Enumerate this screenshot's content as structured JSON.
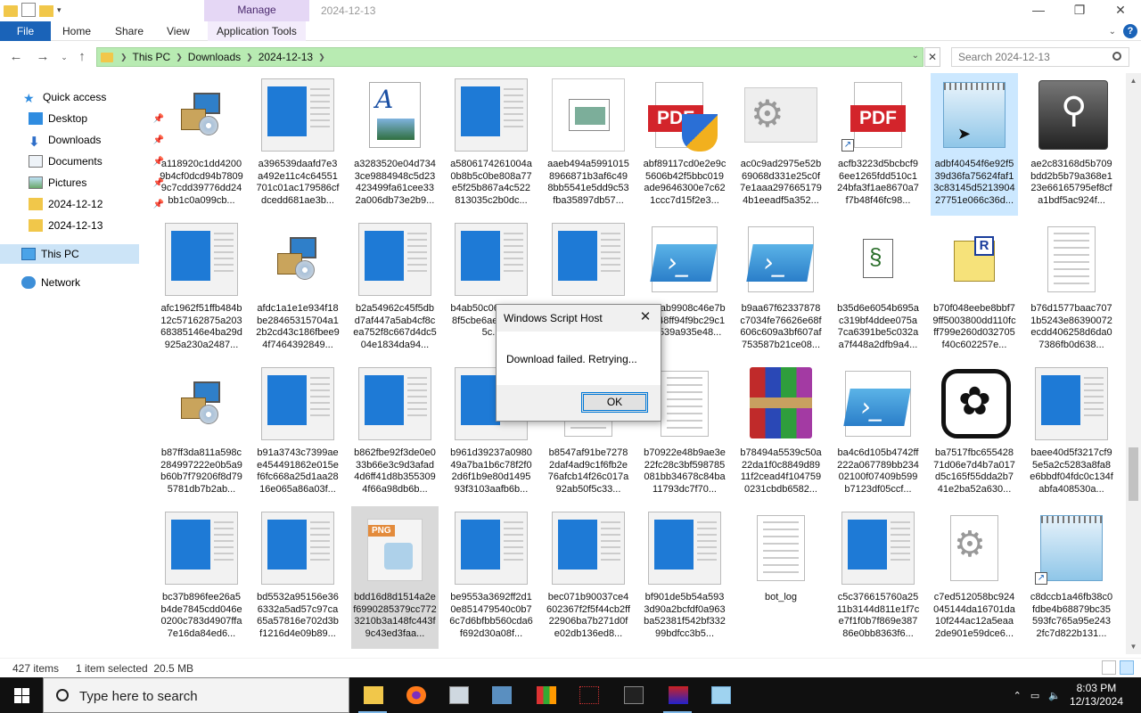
{
  "window": {
    "title": "2024-12-13",
    "manage_tab": "Manage",
    "minimize": "—",
    "restore": "❐",
    "close": "✕"
  },
  "ribbon": {
    "tabs": [
      "File",
      "Home",
      "Share",
      "View",
      "Application Tools"
    ],
    "help": "?"
  },
  "address": {
    "crumbs": [
      "This PC",
      "Downloads",
      "2024-12-13"
    ],
    "search_placeholder": "Search 2024-12-13"
  },
  "nav": {
    "items": [
      {
        "label": "Quick access"
      },
      {
        "label": "Desktop"
      },
      {
        "label": "Downloads"
      },
      {
        "label": "Documents"
      },
      {
        "label": "Pictures"
      },
      {
        "label": "2024-12-12"
      },
      {
        "label": "2024-12-13"
      },
      {
        "label": "This PC"
      },
      {
        "label": "Network"
      }
    ]
  },
  "files": [
    {
      "name": "a118920c1dd42009b4cf0dcd94b78099c7cdd39776dd24bb1c0a099cb...",
      "icon": "installer"
    },
    {
      "name": "a396539daafd7e3a492e11c4c64551701c01ac179586cfdcedd681ae3b...",
      "icon": "doc"
    },
    {
      "name": "a3283520e04d7343ce9884948c5d23423499fa61cee332a006db73e2b9...",
      "icon": "word"
    },
    {
      "name": "a5806174261004a0b8b5c0be808a77e5f25b867a4c522813035c2b0dc...",
      "icon": "doc"
    },
    {
      "name": "aaeb494a59910158966871b3af6c498bb5541e5dd9c53fba35897db57...",
      "icon": "window"
    },
    {
      "name": "abf89117cd0e2e9c5606b42f5bbc019ade9646300e7c621ccc7d15f2e3...",
      "icon": "pdf-shield"
    },
    {
      "name": "ac0c9ad2975e52b69068d331e25c0f7e1aaa2976651794b1eeadf5a352...",
      "icon": "gear"
    },
    {
      "name": "acfb3223d5bcbcf96ee1265fdd510c124bfa3f1ae8670a7f7b48f46fc98...",
      "icon": "pdf-link"
    },
    {
      "name": "adbf40454f6e92f539d36fa75624faf13c83145d521390427751e066c36d...",
      "icon": "notepad-sel"
    },
    {
      "name": "ae2c83168d5b709bdd2b5b79a368e123e66165795ef8cfa1bdf5ac924f...",
      "icon": "usb"
    },
    {
      "name": "afc1962f51ffb484b12c57162875a20368385146e4ba29d925a230a2487...",
      "icon": "doc"
    },
    {
      "name": "afdc1a1e1e934f18be28465315704a12b2cd43c186fbee94f7464392849...",
      "icon": "installer"
    },
    {
      "name": "b2a54962c45f5dbd7af447a5ab4cf8cea752f8c667d4dc504e1834da94...",
      "icon": "doc"
    },
    {
      "name": "b4ab50c06764d4b8f5cbe6aedb5e445c...",
      "icon": "doc"
    },
    {
      "name": "",
      "icon": "doc"
    },
    {
      "name": "b8dab9908c46e7bdf048ff94f9bc29c15b539a935e48...",
      "icon": "ps"
    },
    {
      "name": "b9aa67f62337878c7034fe76626e68f606c609a3bf607af753587b21ce08...",
      "icon": "ps"
    },
    {
      "name": "b35d6e6054b695ac319bf4ddee075a7ca6391be5c032aa7f448a2dfb9a4...",
      "icon": "script"
    },
    {
      "name": "b70f048eebe8bbf79ff5003800dd110fcff799e260d032705f40c602257e...",
      "icon": "rfile"
    },
    {
      "name": "b76d1577baac7071b5243e86390072ecdd406258d6da07386fb0d638...",
      "icon": "text"
    },
    {
      "name": "b87ff3da811a598c284997222e0b5a9b60b7f79206f8d795781db7b2ab...",
      "icon": "installer"
    },
    {
      "name": "b91a3743c7399aee454491862e015ef6fc668a25d1aa2816e065a86a03f...",
      "icon": "doc"
    },
    {
      "name": "b862fbe92f3de0e033b66e3c9d3afad4d6ff41d8b3553094f66a98db6b...",
      "icon": "doc"
    },
    {
      "name": "b961d39237a098049a7ba1b6c78f2f02d6f1b9e80d149593f3103aafb6b...",
      "icon": "doc"
    },
    {
      "name": "b8547af91be72782daf4ad9c1f6fb2e76afcb14f26c017a92ab50f5c33...",
      "icon": "text"
    },
    {
      "name": "b70922e48b9ae3e22fc28c3bf598785081bb34678c84ba11793dc7f70...",
      "icon": "text"
    },
    {
      "name": "b78494a5539c50a22da1f0c8849d8911f2cead4f1047590231cbdb6582...",
      "icon": "rar"
    },
    {
      "name": "ba4c6d105b4742ff222a067789bb23402100f07409b599b7123df05ccf...",
      "icon": "ps"
    },
    {
      "name": "ba7517fbc65542871d06e7d4b7a017d5c165f55dda2b741e2ba52a630...",
      "icon": "openai"
    },
    {
      "name": "baee40d5f3217cf95e5a2c5283a8fa8e6bbdf04fdc0c134fabfa408530a...",
      "icon": "doc"
    },
    {
      "name": "bc37b896fee26a5b4de7845cdd046e0200c783d4907ffa7e16da84ed6...",
      "icon": "doc"
    },
    {
      "name": "bd5532a95156e366332a5ad57c97ca65a57816e702d3bf1216d4e09b89...",
      "icon": "doc"
    },
    {
      "name": "bdd16d8d1514a2ef6990285379cc7723210b3a148fc443f9c43ed3faa...",
      "icon": "png"
    },
    {
      "name": "be9553a3692ff2d10e851479540c0b76c7d6bfbb560cda6f692d30a08f...",
      "icon": "doc"
    },
    {
      "name": "bec071b90037ce4602367f2f5f44cb2ff22906ba7b271d0fe02db136ed8...",
      "icon": "doc"
    },
    {
      "name": "bf901de5b54a5933d90a2bcfdf0a963ba52381f542bf33299bdfcc3b5...",
      "icon": "doc"
    },
    {
      "name": "bot_log",
      "icon": "text"
    },
    {
      "name": "c5c376615760a2511b3144d811e1f7ce7f1f0b7f869e38786e0bb8363f6...",
      "icon": "doc"
    },
    {
      "name": "c7ed512058bc924045144da16701da10f244ac12a5eaa2de901e59dce6...",
      "icon": "gear-doc"
    },
    {
      "name": "c8dccb1a46fb38c0fdbe4b68879bc35593fc765a95e2432fc7d822b131...",
      "icon": "notepad-link"
    }
  ],
  "status": {
    "count": "427 items",
    "selection": "1 item selected  20.5 MB"
  },
  "dialog": {
    "title": "Windows Script Host",
    "message": "Download failed. Retrying...",
    "ok": "OK",
    "close": "✕"
  },
  "taskbar": {
    "search_placeholder": "Type here to search",
    "time": "8:03 PM",
    "date": "12/13/2024"
  }
}
